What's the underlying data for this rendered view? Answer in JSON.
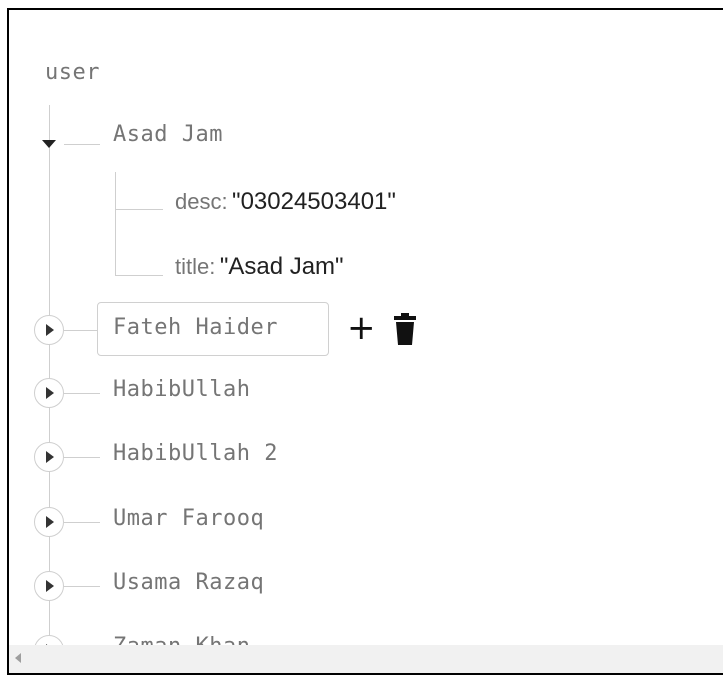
{
  "tree": {
    "root_label": "user",
    "expanded_node": {
      "key": "Asad Jam",
      "fields": [
        {
          "key": "desc:",
          "value": "\"03024503401\""
        },
        {
          "key": "title:",
          "value": "\"Asad Jam\""
        }
      ]
    },
    "hovered_node": {
      "key": "Fateh Haider",
      "add_label": "+",
      "delete_icon": "trash-icon"
    },
    "collapsed_nodes": [
      "HabibUllah",
      "HabibUllah 2",
      "Umar Farooq",
      "Usama Razaq",
      "Zaman Khan"
    ]
  },
  "colors": {
    "key_text": "#757575",
    "value_text": "#212121",
    "tree_line": "#cfcfcf"
  }
}
